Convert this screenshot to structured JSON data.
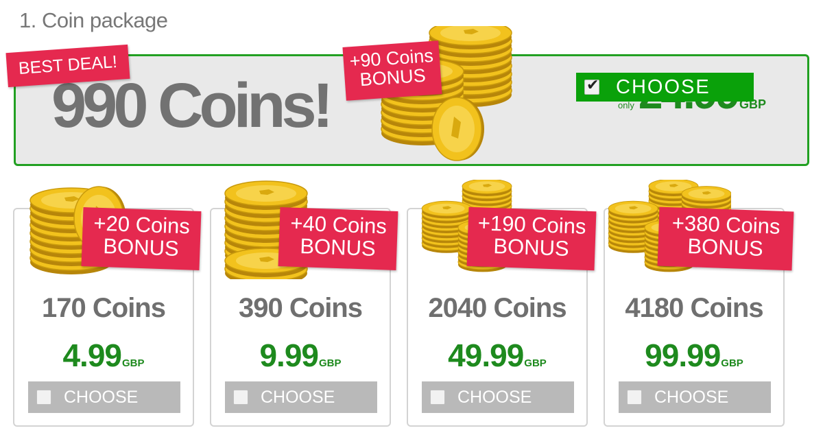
{
  "section_title": "1. Coin package",
  "featured": {
    "badge": "BEST DEAL!",
    "amount": "990 Coins!",
    "bonus_line1": "+90 Coins",
    "bonus_line2": "BONUS",
    "price_prefix": "only",
    "price": "24.99",
    "currency": "GBP",
    "choose_label": "CHOOSE",
    "selected": true
  },
  "packages": [
    {
      "bonus_line1": "+20 Coins",
      "bonus_line2": "BONUS",
      "amount": "170 Coins",
      "price": "4.99",
      "currency": "GBP",
      "choose_label": "CHOOSE",
      "selected": false
    },
    {
      "bonus_line1": "+40 Coins",
      "bonus_line2": "BONUS",
      "amount": "390 Coins",
      "price": "9.99",
      "currency": "GBP",
      "choose_label": "CHOOSE",
      "selected": false
    },
    {
      "bonus_line1": "+190 Coins",
      "bonus_line2": "BONUS",
      "amount": "2040 Coins",
      "price": "49.99",
      "currency": "GBP",
      "choose_label": "CHOOSE",
      "selected": false
    },
    {
      "bonus_line1": "+380 Coins",
      "bonus_line2": "BONUS",
      "amount": "4180 Coins",
      "price": "99.99",
      "currency": "GBP",
      "choose_label": "CHOOSE",
      "selected": false
    }
  ],
  "colors": {
    "accent_green": "#0aa10a",
    "price_green": "#1e8a1e",
    "ribbon_red": "#e5294f",
    "coin_gold": "#f2c21d",
    "disabled_grey": "#b9b9b9"
  },
  "icons": [
    "coin-stack-icon",
    "checkbox-checked-icon",
    "checkbox-icon"
  ]
}
